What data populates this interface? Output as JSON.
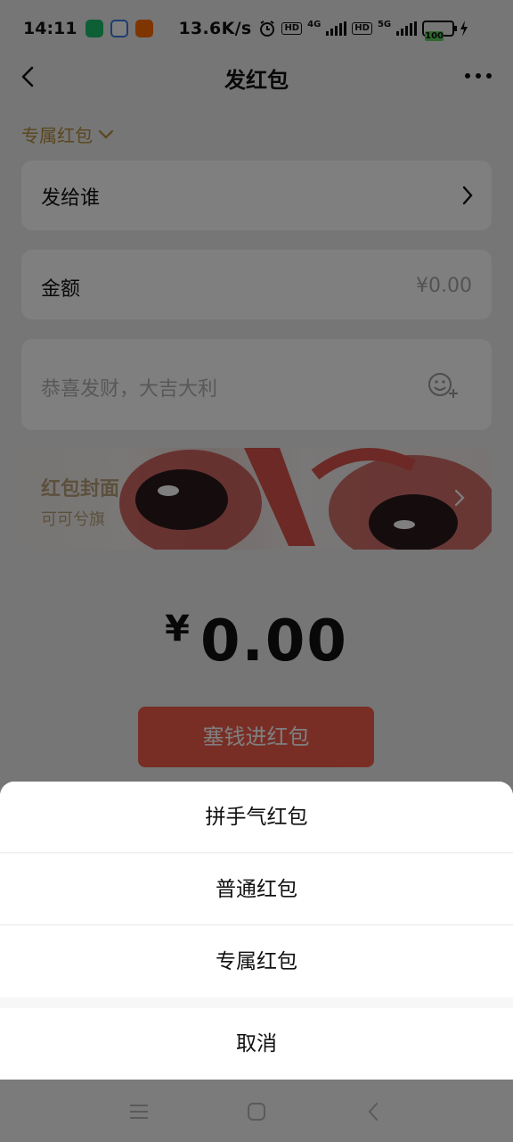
{
  "status_bar": {
    "time": "14:11",
    "net_speed": "13.6K/s",
    "hd1": "HD",
    "net1": "4G",
    "hd2": "HD",
    "net2": "5G",
    "battery": "100"
  },
  "nav": {
    "title": "发红包"
  },
  "type_switch": {
    "label": "专属红包"
  },
  "recipient": {
    "label": "发给谁"
  },
  "amount": {
    "label": "金额",
    "value": "¥0.00"
  },
  "greeting": {
    "placeholder": "恭喜发财，大吉大利"
  },
  "cover": {
    "title": "红包封面",
    "subtitle": "可可兮旗"
  },
  "total": {
    "currency": "¥",
    "value": "0.00"
  },
  "submit_button": {
    "label": "塞钱进红包"
  },
  "action_sheet": {
    "options": [
      {
        "label": "拼手气红包"
      },
      {
        "label": "普通红包"
      },
      {
        "label": "专属红包"
      }
    ],
    "cancel_label": "取消"
  },
  "colors": {
    "accent_red": "#f25542",
    "gold": "#b48c3c",
    "battery_green": "#5fd35f"
  },
  "icons": {
    "back": "back-chevron-icon",
    "more": "more-dots-icon",
    "emoji": "emoji-add-icon",
    "menu": "menu-lines-icon",
    "home": "home-square-icon",
    "nav_back": "nav-back-icon"
  }
}
